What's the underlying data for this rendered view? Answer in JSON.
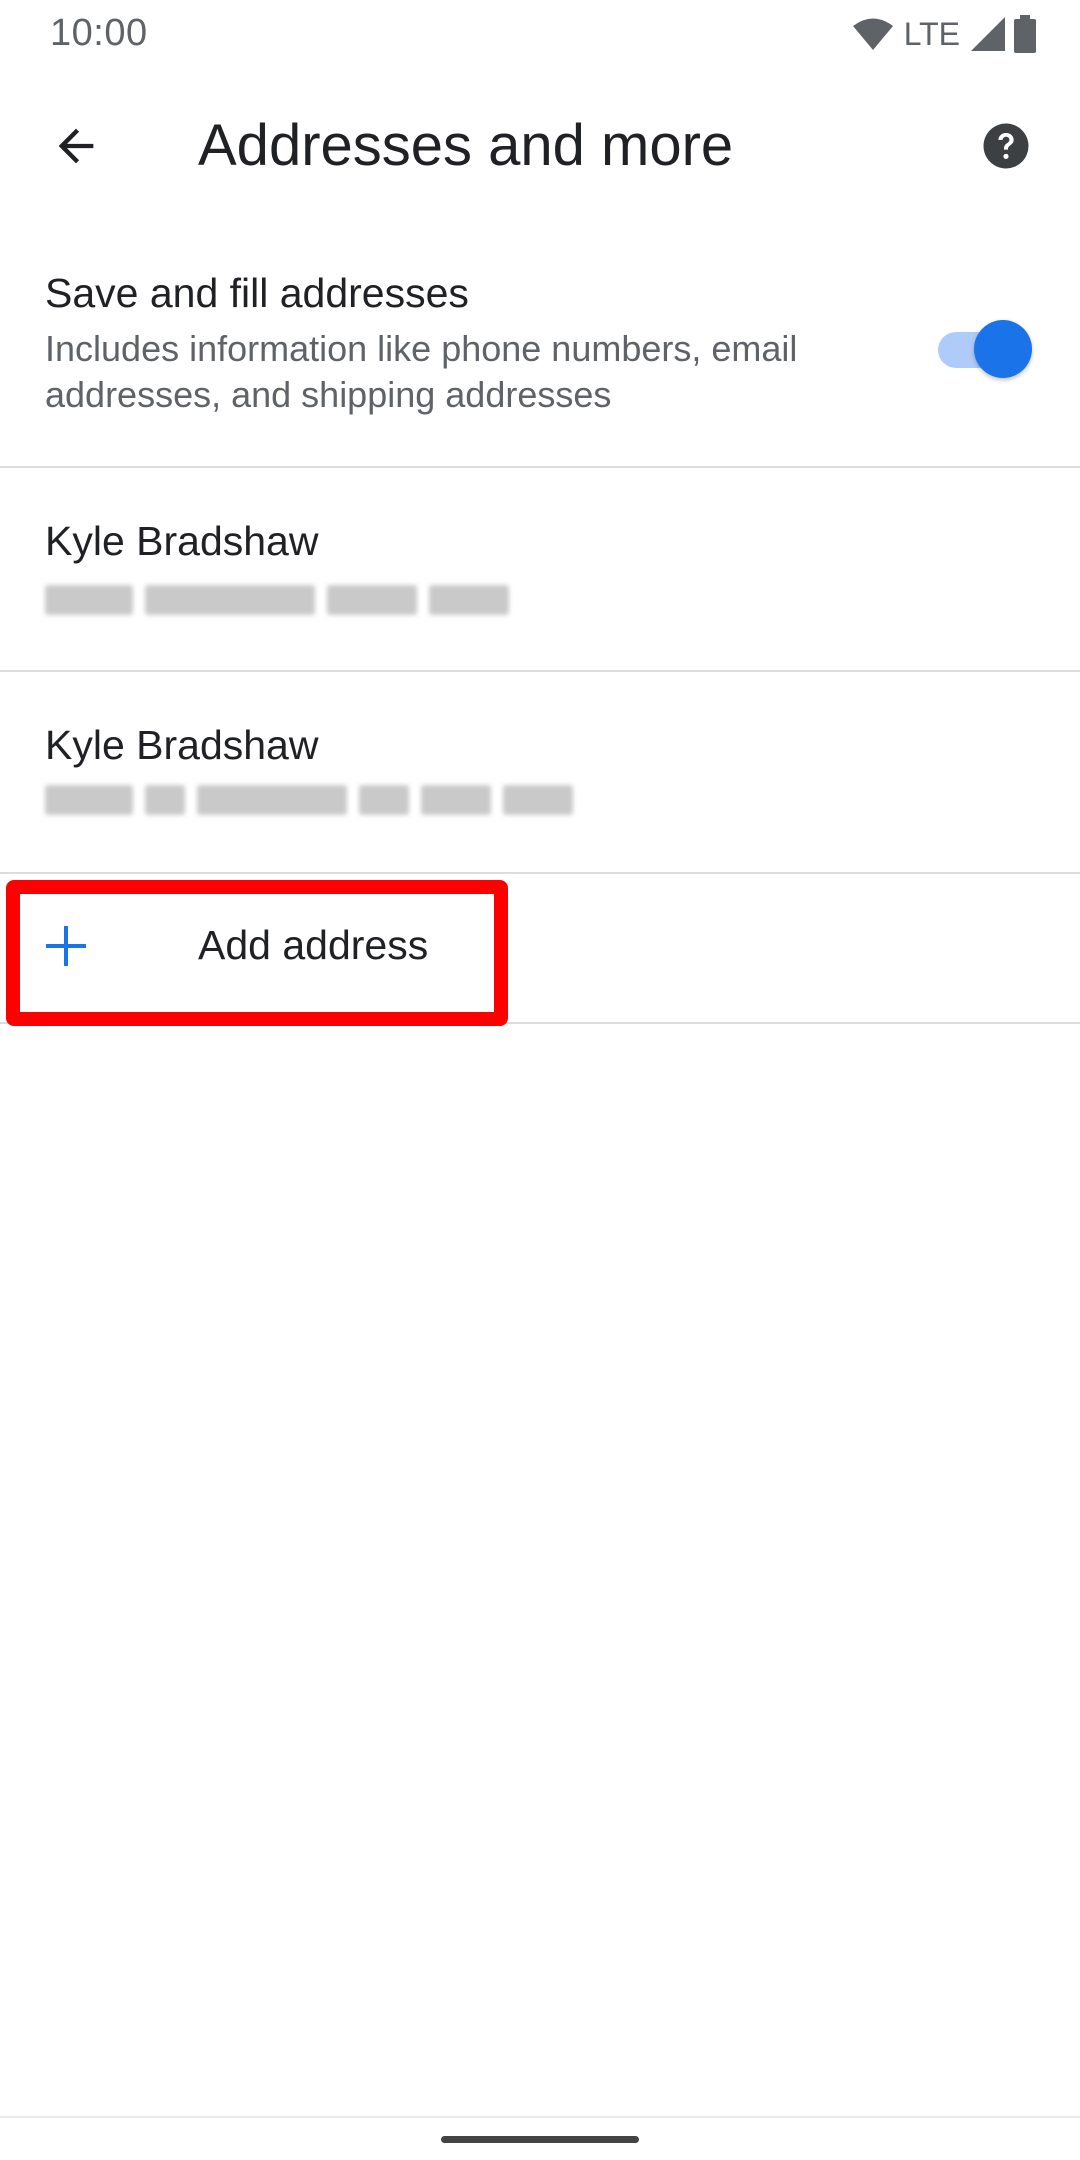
{
  "status_bar": {
    "time": "10:00",
    "network": "LTE"
  },
  "toolbar": {
    "title": "Addresses and more",
    "back_icon": "arrow-back-icon",
    "help_icon": "help-circle-icon"
  },
  "settings": {
    "save_fill": {
      "title": "Save and fill addresses",
      "summary": "Includes information like phone numbers, email addresses, and shipping addresses",
      "enabled": true
    }
  },
  "addresses": [
    {
      "name": "Kyle Bradshaw"
    },
    {
      "name": "Kyle Bradshaw"
    }
  ],
  "add_address": {
    "label": "Add address",
    "icon": "plus-icon"
  },
  "colors": {
    "accent": "#1a73e8",
    "accent_track": "#aecbfa",
    "highlight": "#ff0000",
    "secondary_text": "#5f6368"
  }
}
